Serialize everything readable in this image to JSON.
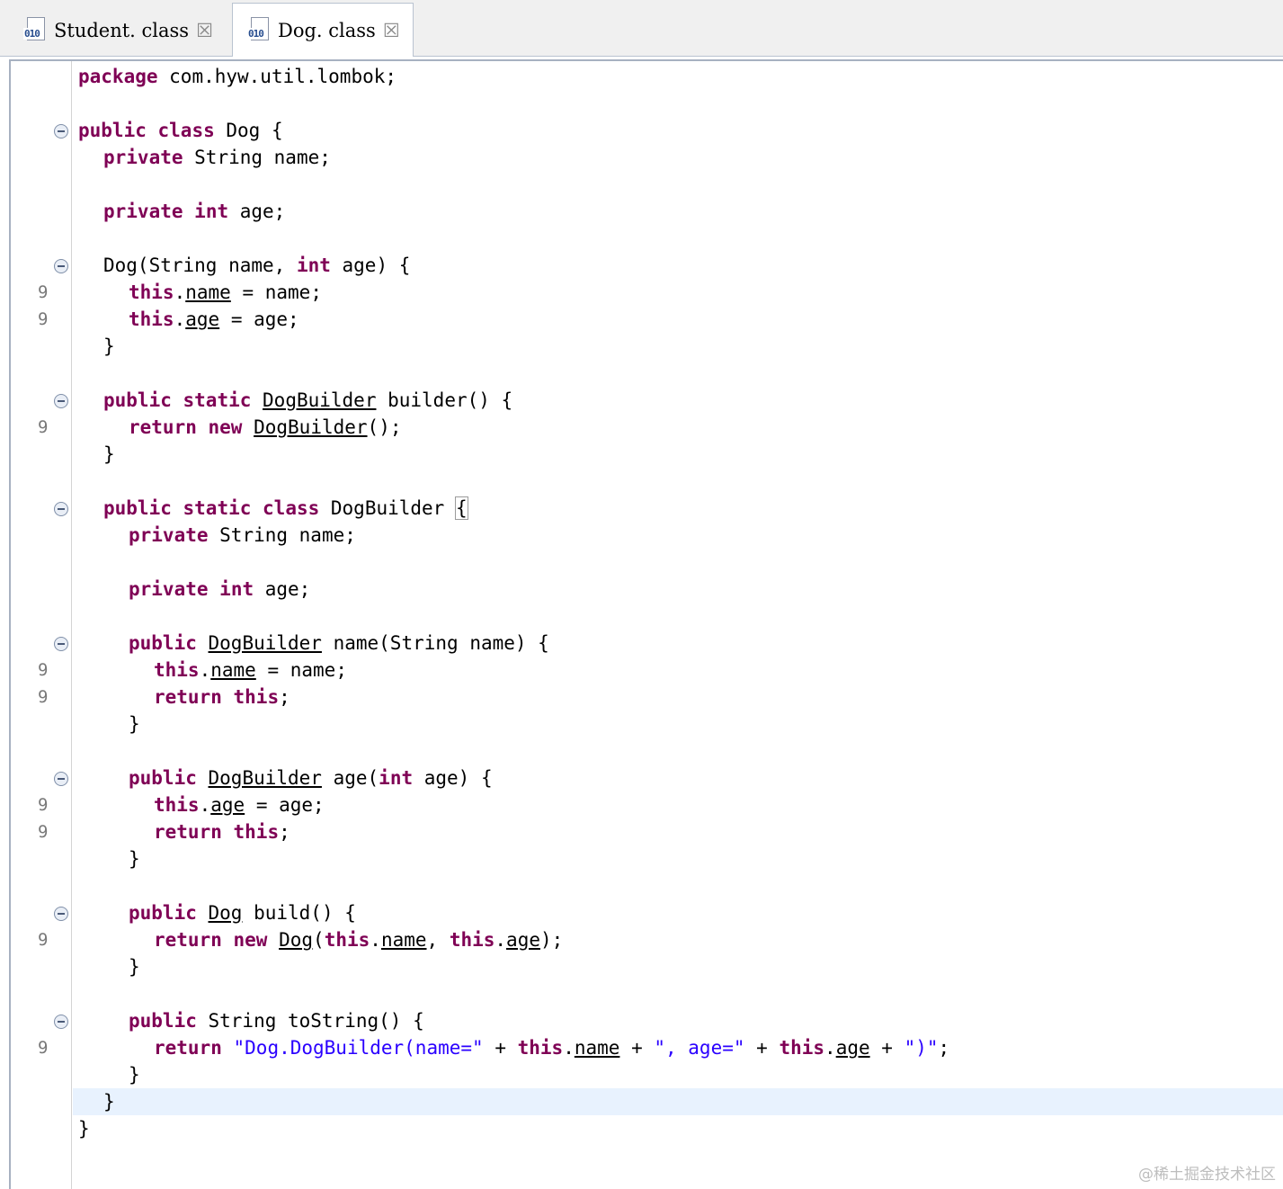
{
  "tabs": [
    {
      "label": "Student. class",
      "icon": "class-file-icon",
      "active": false
    },
    {
      "label": "Dog. class",
      "icon": "class-file-icon",
      "active": true
    }
  ],
  "editor": {
    "current_line": 39,
    "lines": [
      {
        "n": 1,
        "indent": 0,
        "fold": false,
        "num": "",
        "tokens": [
          {
            "t": "package",
            "c": "kw"
          },
          {
            "t": " com.hyw.util.lombok;"
          }
        ]
      },
      {
        "n": 2,
        "indent": 0,
        "fold": false,
        "num": "",
        "tokens": []
      },
      {
        "n": 3,
        "indent": 0,
        "fold": true,
        "num": "",
        "tokens": [
          {
            "t": "public",
            "c": "kw"
          },
          {
            "t": " "
          },
          {
            "t": "class",
            "c": "kw"
          },
          {
            "t": " Dog {"
          }
        ]
      },
      {
        "n": 4,
        "indent": 1,
        "fold": false,
        "num": "",
        "tokens": [
          {
            "t": "private",
            "c": "kw"
          },
          {
            "t": " String name;"
          }
        ]
      },
      {
        "n": 5,
        "indent": 0,
        "fold": false,
        "num": "",
        "tokens": []
      },
      {
        "n": 6,
        "indent": 1,
        "fold": false,
        "num": "",
        "tokens": [
          {
            "t": "private",
            "c": "kw"
          },
          {
            "t": " "
          },
          {
            "t": "int",
            "c": "kw"
          },
          {
            "t": " age;"
          }
        ]
      },
      {
        "n": 7,
        "indent": 0,
        "fold": false,
        "num": "",
        "tokens": []
      },
      {
        "n": 8,
        "indent": 1,
        "fold": true,
        "num": "",
        "tokens": [
          {
            "t": "Dog(String name, "
          },
          {
            "t": "int",
            "c": "kw"
          },
          {
            "t": " age) {"
          }
        ]
      },
      {
        "n": 9,
        "indent": 2,
        "fold": false,
        "num": "9",
        "tokens": [
          {
            "t": "this",
            "c": "kw"
          },
          {
            "t": "."
          },
          {
            "t": "name",
            "c": "u"
          },
          {
            "t": " = name;"
          }
        ]
      },
      {
        "n": 10,
        "indent": 2,
        "fold": false,
        "num": "9",
        "tokens": [
          {
            "t": "this",
            "c": "kw"
          },
          {
            "t": "."
          },
          {
            "t": "age",
            "c": "u"
          },
          {
            "t": " = age;"
          }
        ]
      },
      {
        "n": 11,
        "indent": 1,
        "fold": false,
        "num": "",
        "tokens": [
          {
            "t": "}"
          }
        ]
      },
      {
        "n": 12,
        "indent": 0,
        "fold": false,
        "num": "",
        "tokens": []
      },
      {
        "n": 13,
        "indent": 1,
        "fold": true,
        "num": "",
        "tokens": [
          {
            "t": "public",
            "c": "kw"
          },
          {
            "t": " "
          },
          {
            "t": "static",
            "c": "kw"
          },
          {
            "t": " "
          },
          {
            "t": "DogBuilder",
            "c": "u"
          },
          {
            "t": " builder() {"
          }
        ]
      },
      {
        "n": 14,
        "indent": 2,
        "fold": false,
        "num": "9",
        "tokens": [
          {
            "t": "return",
            "c": "kw"
          },
          {
            "t": " "
          },
          {
            "t": "new",
            "c": "kw"
          },
          {
            "t": " "
          },
          {
            "t": "DogBuilder",
            "c": "u"
          },
          {
            "t": "();"
          }
        ]
      },
      {
        "n": 15,
        "indent": 1,
        "fold": false,
        "num": "",
        "tokens": [
          {
            "t": "}"
          }
        ]
      },
      {
        "n": 16,
        "indent": 0,
        "fold": false,
        "num": "",
        "tokens": []
      },
      {
        "n": 17,
        "indent": 1,
        "fold": true,
        "num": "",
        "tokens": [
          {
            "t": "public",
            "c": "kw"
          },
          {
            "t": " "
          },
          {
            "t": "static",
            "c": "kw"
          },
          {
            "t": " "
          },
          {
            "t": "class",
            "c": "kw"
          },
          {
            "t": " DogBuilder "
          },
          {
            "t": "{",
            "c": "bracket"
          }
        ]
      },
      {
        "n": 18,
        "indent": 2,
        "fold": false,
        "num": "",
        "tokens": [
          {
            "t": "private",
            "c": "kw"
          },
          {
            "t": " String name;"
          }
        ]
      },
      {
        "n": 19,
        "indent": 0,
        "fold": false,
        "num": "",
        "tokens": []
      },
      {
        "n": 20,
        "indent": 2,
        "fold": false,
        "num": "",
        "tokens": [
          {
            "t": "private",
            "c": "kw"
          },
          {
            "t": " "
          },
          {
            "t": "int",
            "c": "kw"
          },
          {
            "t": " age;"
          }
        ]
      },
      {
        "n": 21,
        "indent": 0,
        "fold": false,
        "num": "",
        "tokens": []
      },
      {
        "n": 22,
        "indent": 2,
        "fold": true,
        "num": "",
        "tokens": [
          {
            "t": "public",
            "c": "kw"
          },
          {
            "t": " "
          },
          {
            "t": "DogBuilder",
            "c": "u"
          },
          {
            "t": " name(String name) {"
          }
        ]
      },
      {
        "n": 23,
        "indent": 3,
        "fold": false,
        "num": "9",
        "tokens": [
          {
            "t": "this",
            "c": "kw"
          },
          {
            "t": "."
          },
          {
            "t": "name",
            "c": "u"
          },
          {
            "t": " = name;"
          }
        ]
      },
      {
        "n": 24,
        "indent": 3,
        "fold": false,
        "num": "9",
        "tokens": [
          {
            "t": "return",
            "c": "kw"
          },
          {
            "t": " "
          },
          {
            "t": "this",
            "c": "kw"
          },
          {
            "t": ";"
          }
        ]
      },
      {
        "n": 25,
        "indent": 2,
        "fold": false,
        "num": "",
        "tokens": [
          {
            "t": "}"
          }
        ]
      },
      {
        "n": 26,
        "indent": 0,
        "fold": false,
        "num": "",
        "tokens": []
      },
      {
        "n": 27,
        "indent": 2,
        "fold": true,
        "num": "",
        "tokens": [
          {
            "t": "public",
            "c": "kw"
          },
          {
            "t": " "
          },
          {
            "t": "DogBuilder",
            "c": "u"
          },
          {
            "t": " age("
          },
          {
            "t": "int",
            "c": "kw"
          },
          {
            "t": " age) {"
          }
        ]
      },
      {
        "n": 28,
        "indent": 3,
        "fold": false,
        "num": "9",
        "tokens": [
          {
            "t": "this",
            "c": "kw"
          },
          {
            "t": "."
          },
          {
            "t": "age",
            "c": "u"
          },
          {
            "t": " = age;"
          }
        ]
      },
      {
        "n": 29,
        "indent": 3,
        "fold": false,
        "num": "9",
        "tokens": [
          {
            "t": "return",
            "c": "kw"
          },
          {
            "t": " "
          },
          {
            "t": "this",
            "c": "kw"
          },
          {
            "t": ";"
          }
        ]
      },
      {
        "n": 30,
        "indent": 2,
        "fold": false,
        "num": "",
        "tokens": [
          {
            "t": "}"
          }
        ]
      },
      {
        "n": 31,
        "indent": 0,
        "fold": false,
        "num": "",
        "tokens": []
      },
      {
        "n": 32,
        "indent": 2,
        "fold": true,
        "num": "",
        "tokens": [
          {
            "t": "public",
            "c": "kw"
          },
          {
            "t": " "
          },
          {
            "t": "Dog",
            "c": "u"
          },
          {
            "t": " build() {"
          }
        ]
      },
      {
        "n": 33,
        "indent": 3,
        "fold": false,
        "num": "9",
        "tokens": [
          {
            "t": "return",
            "c": "kw"
          },
          {
            "t": " "
          },
          {
            "t": "new",
            "c": "kw"
          },
          {
            "t": " "
          },
          {
            "t": "Dog",
            "c": "u"
          },
          {
            "t": "("
          },
          {
            "t": "this",
            "c": "kw"
          },
          {
            "t": "."
          },
          {
            "t": "name",
            "c": "u"
          },
          {
            "t": ", "
          },
          {
            "t": "this",
            "c": "kw"
          },
          {
            "t": "."
          },
          {
            "t": "age",
            "c": "u"
          },
          {
            "t": ");"
          }
        ]
      },
      {
        "n": 34,
        "indent": 2,
        "fold": false,
        "num": "",
        "tokens": [
          {
            "t": "}"
          }
        ]
      },
      {
        "n": 35,
        "indent": 0,
        "fold": false,
        "num": "",
        "tokens": []
      },
      {
        "n": 36,
        "indent": 2,
        "fold": true,
        "num": "",
        "tokens": [
          {
            "t": "public",
            "c": "kw"
          },
          {
            "t": " String toString() {"
          }
        ]
      },
      {
        "n": 37,
        "indent": 3,
        "fold": false,
        "num": "9",
        "tokens": [
          {
            "t": "return",
            "c": "kw"
          },
          {
            "t": " "
          },
          {
            "t": "\"Dog.DogBuilder(name=\"",
            "c": "str"
          },
          {
            "t": " + "
          },
          {
            "t": "this",
            "c": "kw"
          },
          {
            "t": "."
          },
          {
            "t": "name",
            "c": "u"
          },
          {
            "t": " + "
          },
          {
            "t": "\", age=\"",
            "c": "str"
          },
          {
            "t": " + "
          },
          {
            "t": "this",
            "c": "kw"
          },
          {
            "t": "."
          },
          {
            "t": "age",
            "c": "u"
          },
          {
            "t": " + "
          },
          {
            "t": "\")\"",
            "c": "str"
          },
          {
            "t": ";"
          }
        ]
      },
      {
        "n": 38,
        "indent": 2,
        "fold": false,
        "num": "",
        "tokens": [
          {
            "t": "}"
          }
        ]
      },
      {
        "n": 39,
        "indent": 1,
        "fold": false,
        "num": "",
        "tokens": [
          {
            "t": "}"
          }
        ]
      },
      {
        "n": 40,
        "indent": 0,
        "fold": false,
        "num": "",
        "tokens": [
          {
            "t": "}"
          }
        ]
      }
    ]
  },
  "watermark": "@稀土掘金技术社区"
}
